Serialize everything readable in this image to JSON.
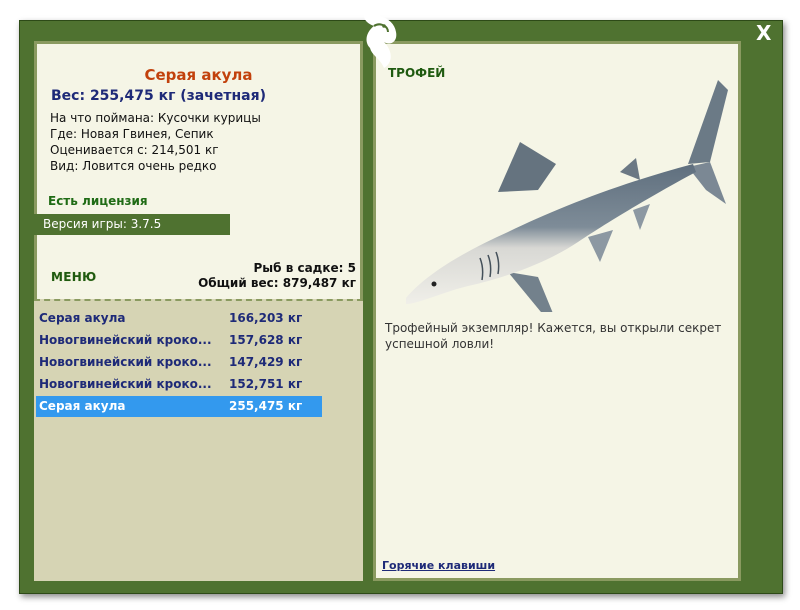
{
  "close_label": "X",
  "fish": {
    "name": "Серая акула",
    "weight_line": "Вес: 255,475 кг (зачетная)",
    "bait": "На что поймана: Кусочки курицы",
    "location": "Где: Новая Гвинея, Сепик",
    "rated_from": "Оценивается с: 214,501 кг",
    "rarity": "Вид: Ловится очень редко"
  },
  "license": "Есть лицензия",
  "version": "Версия игры: 3.7.5",
  "menu_label": "МЕНЮ",
  "cage": {
    "count": "Рыб в садке: 5",
    "total": "Общий вес: 879,487 кг"
  },
  "catch_list": [
    {
      "name": "Серая акула",
      "weight": "166,203 кг"
    },
    {
      "name": "Новогвинейский кроко...",
      "weight": "157,628 кг"
    },
    {
      "name": "Новогвинейский кроко...",
      "weight": "147,429 кг"
    },
    {
      "name": "Новогвинейский кроко...",
      "weight": "152,751 кг"
    },
    {
      "name": "Серая акула",
      "weight": "255,475 кг",
      "selected": true
    }
  ],
  "trophy_label": "ТРОФЕЙ",
  "trophy_text": "Трофейный экземпляр! Кажется, вы открыли секрет успешной ловли!",
  "hotkeys_label": "Горячие клавиши",
  "colors": {
    "frame": "#4f7230",
    "panel": "#f5f5e6",
    "selection": "#3399ee",
    "title": "#c2410c",
    "link": "#1e2a78"
  }
}
